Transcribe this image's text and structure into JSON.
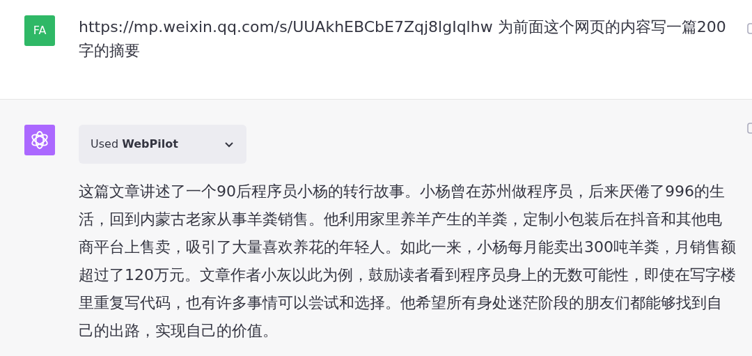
{
  "messages": [
    {
      "kind": "user",
      "avatar": "FA",
      "text": "https://mp.weixin.qq.com/s/UUAkhEBCbE7Zqj8lgIqlhw 为前面这个网页的内容写一篇200字的摘要"
    },
    {
      "kind": "assistant",
      "plugin": {
        "text": "Used **WebPilot**",
        "expanded": false
      },
      "text": "这篇文章讲述了一个90后程序员小杨的转行故事。小杨曾在苏州做程序员，后来厌倦了996的生活，回到内蒙古老家从事羊粪销售。他利用家里养羊产生的羊粪，定制小包装后在抖音和其他电商平台上售卖，吸引了大量喜欢养花的年轻人。如此一来，小杨每月能卖出300吨羊粪，月销售额超过了120万元。文章作者小灰以此为例，鼓励读者看到程序员身上的无数可能性，即使在写字楼里重复写代码，也有许多事情可以尝试和选择。他希望所有身处迷茫阶段的朋友们都能够找到自己的出路，实现自己的价值。"
    }
  ]
}
